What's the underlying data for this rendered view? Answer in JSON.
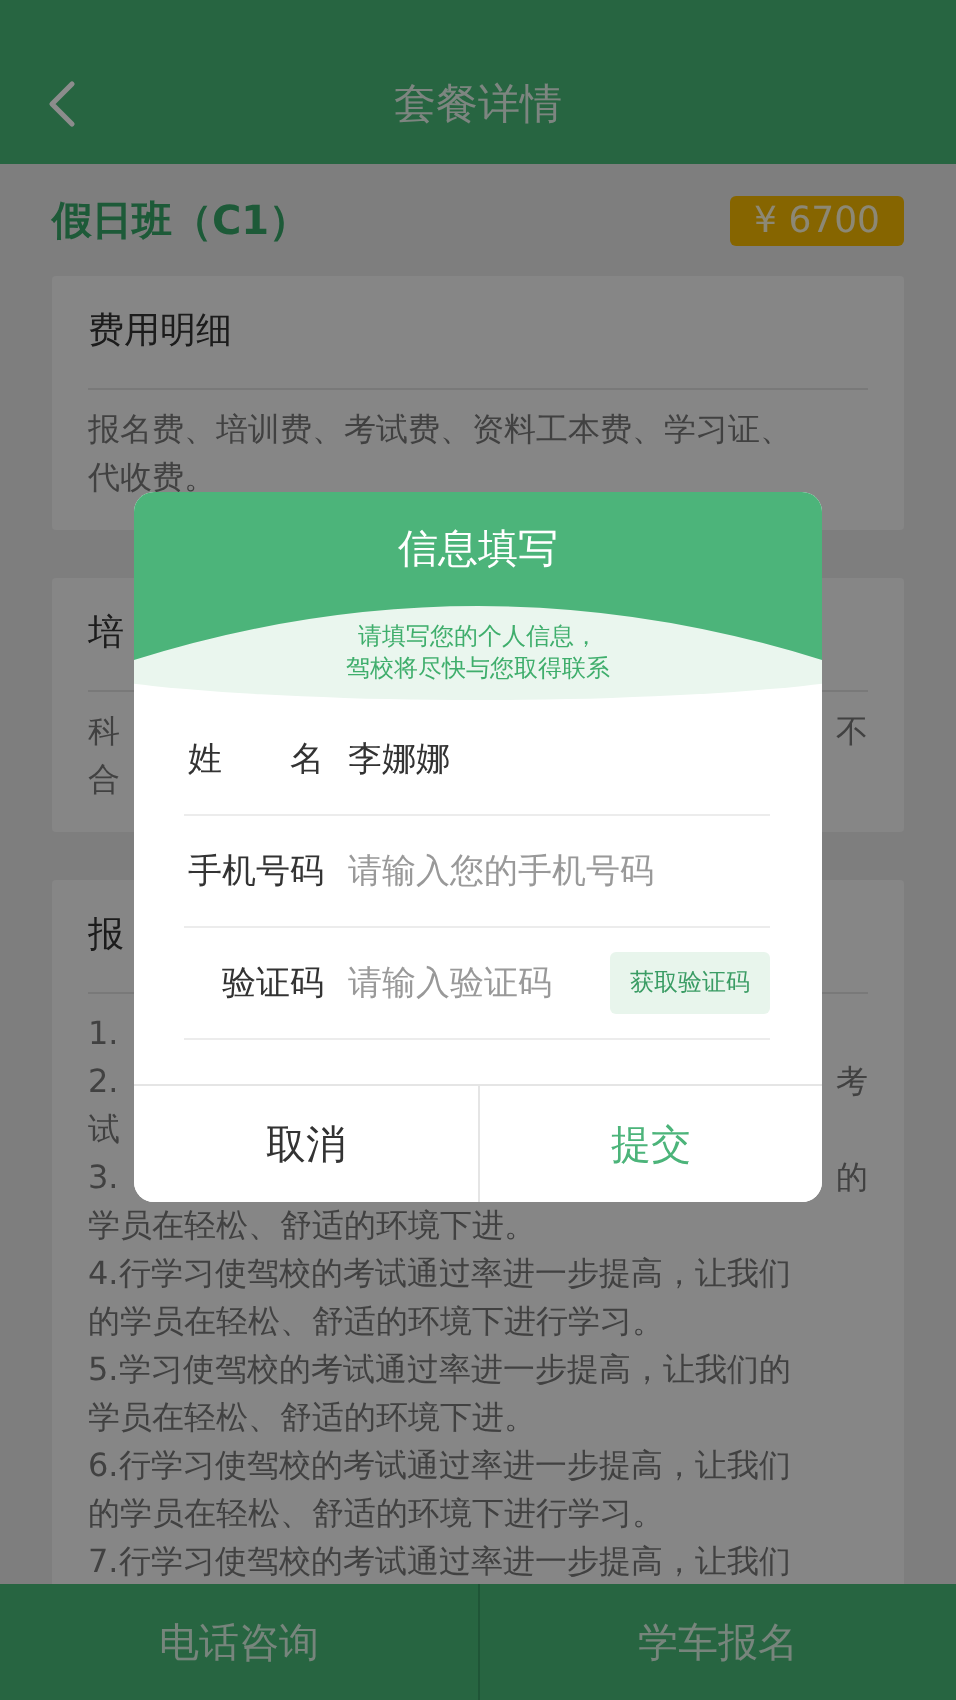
{
  "header": {
    "title": "套餐详情"
  },
  "package": {
    "name": "假日班（C1）",
    "price": "¥ 6700"
  },
  "sections": [
    {
      "heading": "费用明细",
      "lines": [
        {
          "text": "报名费、培训费、考试费、资料工本费、学习证、"
        },
        {
          "text": "代收费。"
        }
      ]
    },
    {
      "heading": "培",
      "lines": [
        {
          "text": "科",
          "text_right": "不"
        },
        {
          "text": "合"
        }
      ]
    },
    {
      "heading": "报",
      "lines": [
        {
          "text": "1."
        },
        {
          "text": "2.",
          "text_right": "考"
        },
        {
          "text": "试"
        },
        {
          "text": "3.",
          "text_right": "的"
        },
        {
          "text": "学员在轻松、舒适的环境下进。"
        },
        {
          "text": "4.行学习使驾校的考试通过率进一步提高，让我们"
        },
        {
          "text": "的学员在轻松、舒适的环境下进行学习。"
        },
        {
          "text": "5.学习使驾校的考试通过率进一步提高，让我们的"
        },
        {
          "text": "学员在轻松、舒适的环境下进。"
        },
        {
          "text": "6.行学习使驾校的考试通过率进一步提高，让我们"
        },
        {
          "text": "的学员在轻松、舒适的环境下进行学习。"
        },
        {
          "text": "7.行学习使驾校的考试通过率进一步提高，让我们"
        }
      ]
    }
  ],
  "dialog": {
    "title": "信息填写",
    "subtitle_lines": [
      "请填写您的个人信息，",
      "驾校将尽快与您取得联系"
    ],
    "fields": [
      {
        "label": "姓　　名",
        "value": "李娜娜"
      },
      {
        "label": "手机号码",
        "placeholder": "请输入您的手机号码"
      },
      {
        "label": "验证码",
        "placeholder": "请输入验证码",
        "action": "获取验证码"
      }
    ],
    "buttons": [
      {
        "label": "取消",
        "kind": "cancel"
      },
      {
        "label": "提交",
        "kind": "primary"
      }
    ]
  },
  "bottom_bar": {
    "buttons": [
      "电话咨询",
      "学车报名"
    ]
  }
}
